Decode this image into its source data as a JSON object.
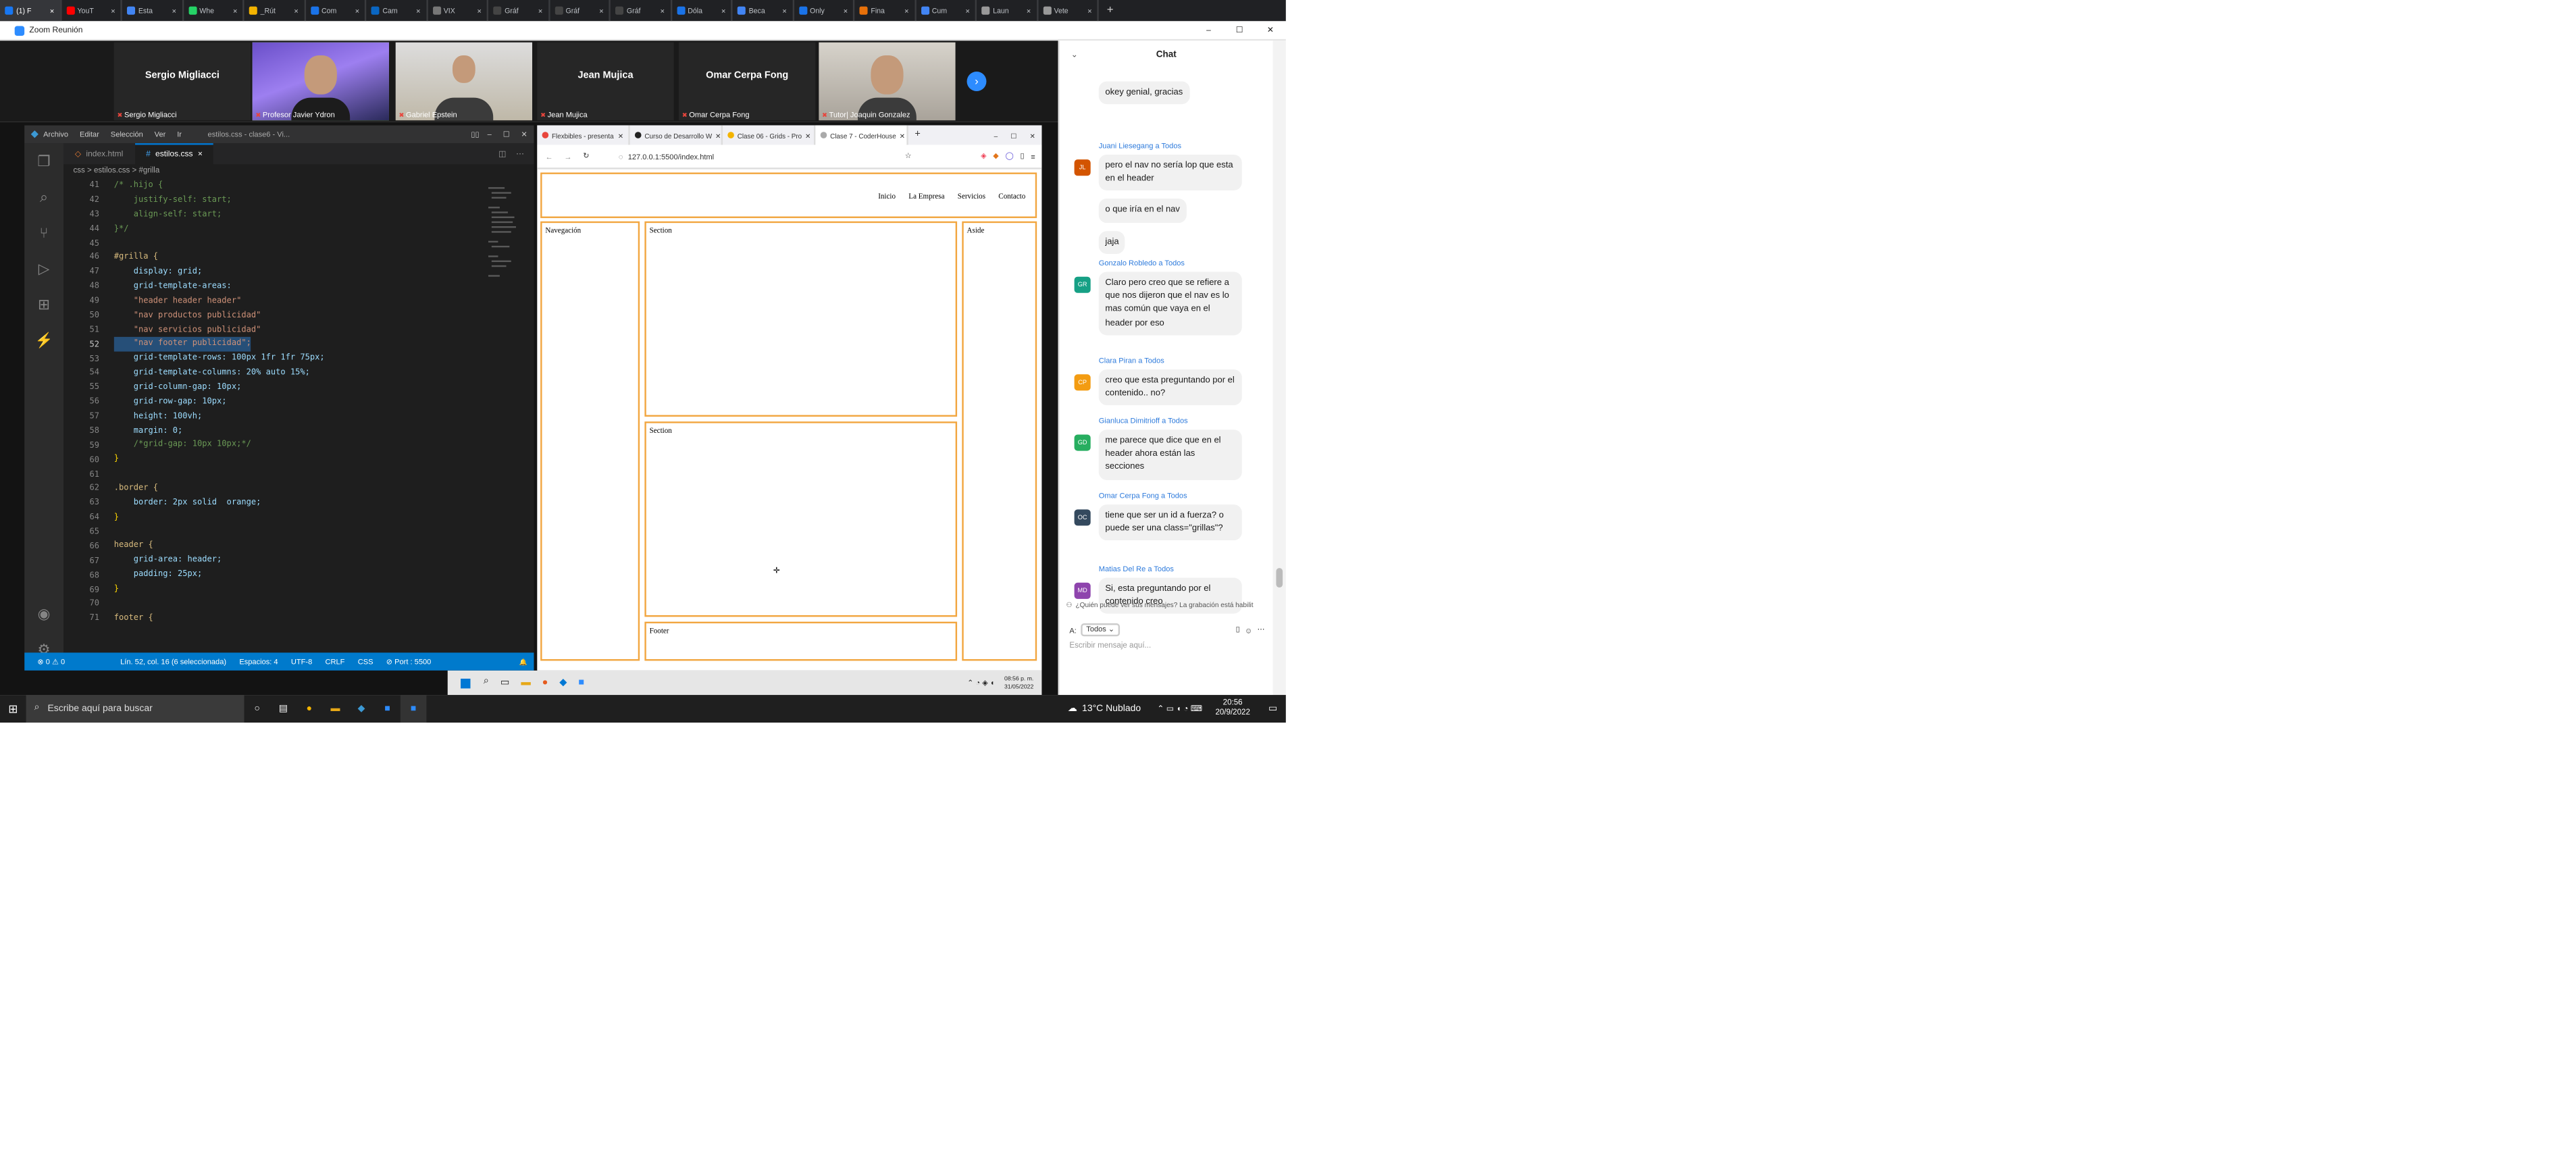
{
  "browser_tabs": [
    {
      "label": "(1) F",
      "color": "#1877f2",
      "icon": "facebook-icon"
    },
    {
      "label": "YouT",
      "color": "#ff0000",
      "icon": "youtube-icon"
    },
    {
      "label": "Esta",
      "color": "#4285f4",
      "icon": "document-icon"
    },
    {
      "label": "Whe",
      "color": "#25d366",
      "icon": "whatsapp-icon"
    },
    {
      "label": "_Rút",
      "color": "#f4b400",
      "icon": "drive-icon"
    },
    {
      "label": "Com",
      "color": "#1a73e8",
      "icon": "zoom-icon"
    },
    {
      "label": "Cam",
      "color": "#0a66c2",
      "icon": "linkedin-icon"
    },
    {
      "label": "VIX",
      "color": "#777777",
      "icon": "globe-icon"
    },
    {
      "label": "Gráf",
      "color": "#444444",
      "icon": "table-icon"
    },
    {
      "label": "Gráf",
      "color": "#444444",
      "icon": "table-icon"
    },
    {
      "label": "Gráf",
      "color": "#444444",
      "icon": "table-icon"
    },
    {
      "label": "Dóla",
      "color": "#1a73e8",
      "icon": "globe-icon"
    },
    {
      "label": "Beca",
      "color": "#4285f4",
      "icon": "document-icon"
    },
    {
      "label": "Only",
      "color": "#1a73e8",
      "icon": "link-icon"
    },
    {
      "label": "Fina",
      "color": "#e8710a",
      "icon": "globe-icon"
    },
    {
      "label": "Cum",
      "color": "#4285f4",
      "icon": "document-icon"
    },
    {
      "label": "Laun",
      "color": "#999999",
      "icon": "globe-icon"
    },
    {
      "label": "Vete",
      "color": "#999999",
      "icon": "globe-icon"
    }
  ],
  "zoom": {
    "window_title": "Zoom Reunión"
  },
  "gallery": [
    {
      "name": "Sergio Migliacci",
      "label": "Sergio Migliacci",
      "video": false
    },
    {
      "name": "",
      "label": "Profesor Javier Ydron",
      "video": true,
      "active": true
    },
    {
      "name": "",
      "label": "Gabriel Epstein",
      "video": true
    },
    {
      "name": "Jean Mujica",
      "label": "Jean Mujica",
      "video": false
    },
    {
      "name": "Omar Cerpa Fong",
      "label": "Omar Cerpa Fong",
      "video": false
    },
    {
      "name": "",
      "label": "Tutor| Joaquin Gonzalez",
      "video": true
    }
  ],
  "vscode": {
    "menu": [
      "Archivo",
      "Editar",
      "Selección",
      "Ver",
      "Ir"
    ],
    "title": "estilos.css - clase6 - Vi...",
    "tabs": [
      {
        "label": "index.html",
        "active": false
      },
      {
        "label": "estilos.css",
        "active": true,
        "close": "×"
      }
    ],
    "breadcrumb": "css  >  estilos.css  >  #grilla",
    "lines": [
      "41",
      "42",
      "43",
      "44",
      "45",
      "46",
      "47",
      "48",
      "49",
      "50",
      "51",
      "52",
      "53",
      "54",
      "55",
      "56",
      "57",
      "58",
      "59",
      "60",
      "61",
      "62",
      "63",
      "64",
      "65",
      "66",
      "67",
      "68",
      "69",
      "70",
      "71"
    ],
    "code": [
      "/* .hijo {",
      "    justify-self: start;",
      "    align-self: start;",
      "}*/",
      "",
      "#grilla {",
      "    display: grid;",
      "    grid-template-areas:",
      "    \"header header header\"",
      "    \"nav productos publicidad\"",
      "    \"nav servicios publicidad\"",
      "    \"nav footer publicidad\";",
      "    grid-template-rows: 100px 1fr 1fr 75px;",
      "    grid-template-columns: 20% auto 15%;",
      "    grid-column-gap: 10px;",
      "    grid-row-gap: 10px;",
      "    height: 100vh;",
      "    margin: 0;",
      "    /*grid-gap: 10px 10px;*/",
      "}",
      "",
      ".border {",
      "    border: 2px solid  orange;",
      "}",
      "",
      "header {",
      "    grid-area: header;",
      "    padding: 25px;",
      "}",
      "",
      "footer {"
    ],
    "status": {
      "problems": "⊗ 0  ⚠ 0",
      "position": "Lín. 52, col. 16 (6 seleccionada)",
      "spaces": "Espacios: 4",
      "encoding": "UTF-8",
      "eol": "CRLF",
      "lang": "CSS",
      "port": "⊘ Port : 5500"
    }
  },
  "browser": {
    "tabs": [
      {
        "label": "Flexbibles - presenta"
      },
      {
        "label": "Curso de Desarrollo W"
      },
      {
        "label": "Clase 06 - Grids - Pro"
      },
      {
        "label": "Clase 7 - CoderHouse",
        "active": true
      }
    ],
    "url": "127.0.0.1:5500/index.html",
    "nav_links": [
      "Inicio",
      "La Empresa",
      "Servicios",
      "Contacto"
    ],
    "boxes": {
      "nav": "Navegación",
      "section1": "Section",
      "section2": "Section",
      "aside": "Aside",
      "footer": "Footer"
    }
  },
  "mini_taskbar": {
    "time": "08:56 p. m.",
    "date": "31/05/2022"
  },
  "chat": {
    "title": "Chat",
    "messages": [
      {
        "sender": "",
        "initials": "",
        "avatar": "",
        "lines": [
          "okey genial, gracias"
        ]
      },
      {
        "sender": "Juani Liesegang a Todos",
        "initials": "JL",
        "avatar": "#d35400",
        "lines": [
          "pero el nav no sería lop que esta en el header",
          "o que iría en el nav",
          "jaja"
        ]
      },
      {
        "sender": "Gonzalo Robledo a Todos",
        "initials": "GR",
        "avatar": "#16a085",
        "lines": [
          "Claro pero creo que se refiere a que nos dijeron que el nav es lo mas común que vaya en el header por eso"
        ]
      },
      {
        "sender": "Clara Piran a Todos",
        "initials": "CP",
        "avatar": "#f39c12",
        "lines": [
          "creo que esta preguntando por el contenido.. no?"
        ]
      },
      {
        "sender": "Gianluca Dimitrioff a Todos",
        "initials": "GD",
        "avatar": "#27ae60",
        "lines": [
          "me parece que dice que en el header ahora están las secciones"
        ]
      },
      {
        "sender": "Omar Cerpa Fong a Todos",
        "initials": "OC",
        "avatar": "#34495e",
        "lines": [
          "tiene que ser un id a fuerza? o puede ser una class=\"grillas\"?"
        ]
      },
      {
        "sender": "Matias Del Re a Todos",
        "initials": "MD",
        "avatar": "#8e44ad",
        "lines": [
          "Si, esta preguntando por el contenido creo"
        ]
      }
    ],
    "notice": "¿Quién puede ver sus mensajes? La grabación está habilit",
    "to_label": "A:",
    "to_value": "Todos",
    "placeholder": "Escribir mensaje aquí..."
  },
  "windows_taskbar": {
    "search_placeholder": "Escribe aquí para buscar",
    "weather": "13°C  Nublado",
    "time": "20:56",
    "date": "20/9/2022"
  },
  "colors": {
    "accent": "#007acc",
    "border_orange": "#f2a640",
    "zoom_blue": "#2e7bdc"
  }
}
